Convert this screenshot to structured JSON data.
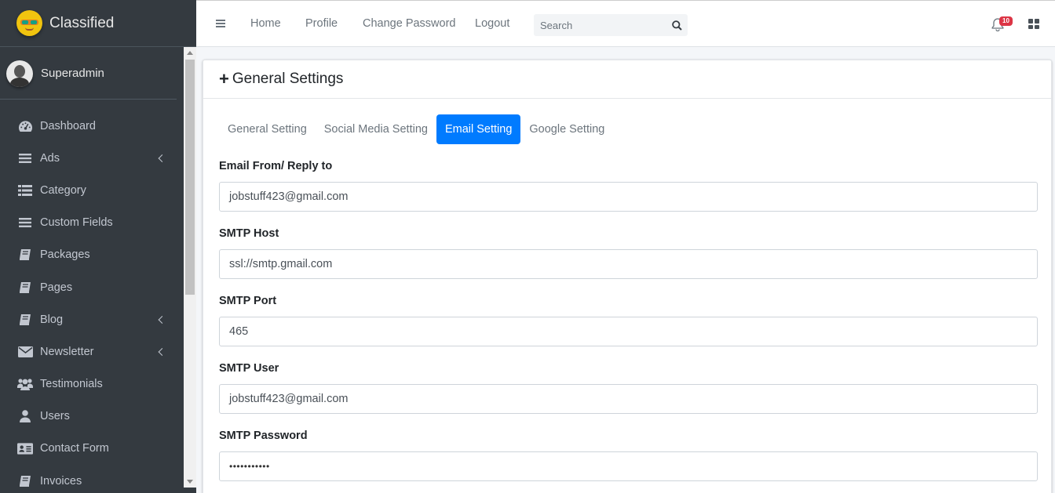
{
  "brand": {
    "name": "Classified"
  },
  "user": {
    "name": "Superadmin"
  },
  "sidebar": {
    "items": [
      {
        "label": "Dashboard",
        "icon": "dashboard-icon",
        "has_submenu": false
      },
      {
        "label": "Ads",
        "icon": "bars-icon",
        "has_submenu": true
      },
      {
        "label": "Category",
        "icon": "list-icon",
        "has_submenu": false
      },
      {
        "label": "Custom Fields",
        "icon": "bars-icon",
        "has_submenu": false
      },
      {
        "label": "Packages",
        "icon": "book-icon",
        "has_submenu": false
      },
      {
        "label": "Pages",
        "icon": "book-icon",
        "has_submenu": false
      },
      {
        "label": "Blog",
        "icon": "book-icon",
        "has_submenu": true
      },
      {
        "label": "Newsletter",
        "icon": "envelope-icon",
        "has_submenu": true
      },
      {
        "label": "Testimonials",
        "icon": "users-icon",
        "has_submenu": false
      },
      {
        "label": "Users",
        "icon": "user-icon",
        "has_submenu": false
      },
      {
        "label": "Contact Form",
        "icon": "address-card-icon",
        "has_submenu": false
      },
      {
        "label": "Invoices",
        "icon": "book-icon",
        "has_submenu": false
      }
    ]
  },
  "topnav": {
    "links": [
      "Home",
      "Profile",
      "Change Password",
      "Logout"
    ],
    "search_placeholder": "Search",
    "notification_count": "10"
  },
  "page": {
    "title": "General Settings",
    "tabs": [
      {
        "label": "General Setting",
        "active": false
      },
      {
        "label": "Social Media Setting",
        "active": false
      },
      {
        "label": "Email Setting",
        "active": true
      },
      {
        "label": "Google Setting",
        "active": false
      }
    ],
    "fields": [
      {
        "label": "Email From/ Reply to",
        "value": "jobstuff423@gmail.com"
      },
      {
        "label": "SMTP Host",
        "value": "ssl://smtp.gmail.com"
      },
      {
        "label": "SMTP Port",
        "value": "465"
      },
      {
        "label": "SMTP User",
        "value": "jobstuff423@gmail.com"
      },
      {
        "label": "SMTP Password",
        "value": "•••••••••••"
      }
    ]
  },
  "colors": {
    "sidebar_bg": "#343a40",
    "accent": "#007bff",
    "badge": "#dc3545"
  }
}
